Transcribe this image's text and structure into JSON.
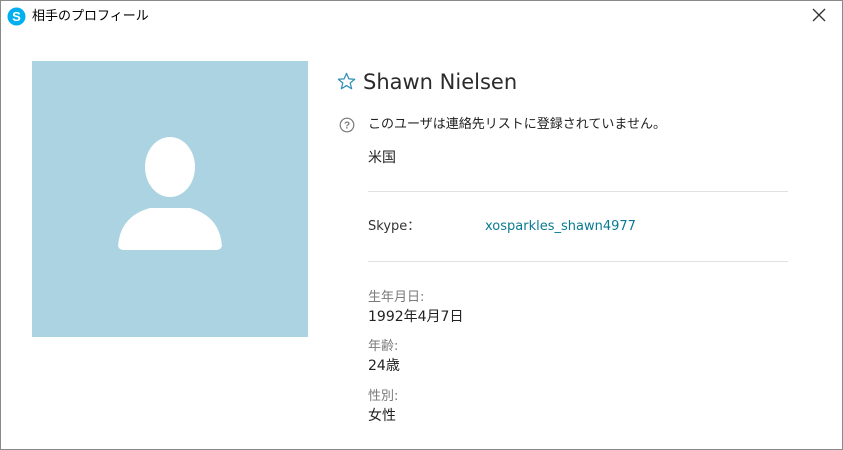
{
  "window": {
    "title": "相手のプロフィール",
    "app_icon": "skype-icon",
    "close_icon": "close-icon",
    "accent_color": "#00aff0"
  },
  "profile": {
    "avatar_icon": "default-user-icon",
    "avatar_bg_color": "#abd3e2",
    "favorite_icon": "star-outline-icon",
    "display_name": "Shawn Nielsen",
    "info_icon": "question-circle-icon",
    "not_in_contacts_text": "このユーザは連絡先リストに登録されていません。",
    "location": "米国",
    "skype_label": "Skype：",
    "skype_id": "xosparkles_shawn4977",
    "skype_id_color": "#0a7a92"
  },
  "details": {
    "birthday_label": "生年月日:",
    "birthday_value": "1992年4月7日",
    "age_label": "年齢:",
    "age_value": "24歳",
    "gender_label": "性別:",
    "gender_value": "女性"
  }
}
